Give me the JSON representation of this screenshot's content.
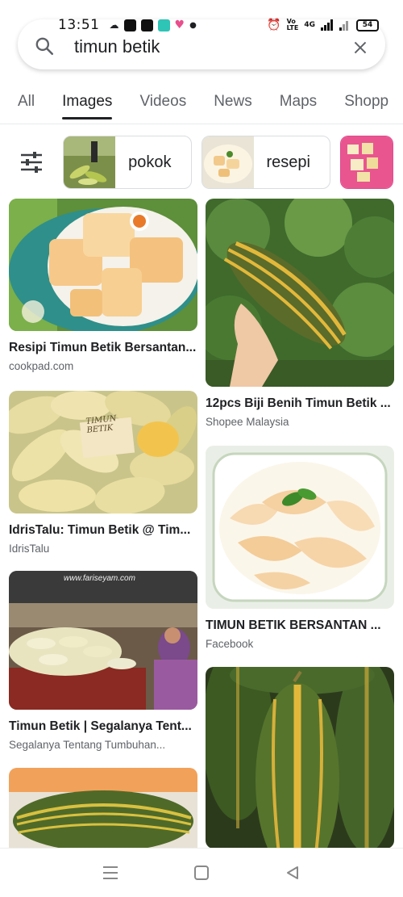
{
  "status_bar": {
    "time": "13:51",
    "right_text": "4G",
    "battery": "54"
  },
  "search": {
    "query": "timun betik"
  },
  "tabs": [
    {
      "label": "All"
    },
    {
      "label": "Images"
    },
    {
      "label": "Videos"
    },
    {
      "label": "News"
    },
    {
      "label": "Maps"
    },
    {
      "label": "Shopp"
    }
  ],
  "chips": [
    {
      "label": "pokok"
    },
    {
      "label": "resepi"
    }
  ],
  "results": {
    "left": [
      {
        "title": "Resipi Timun Betik Bersantan...",
        "source": "cookpad.com"
      },
      {
        "title": "IdrisTalu: Timun Betik @ Tim...",
        "source": "IdrisTalu",
        "image_text": "TIMUN BETIK"
      },
      {
        "title": "Timun Betik | Segalanya Tent...",
        "source": "Segalanya Tentang Tumbuhan...",
        "image_text": "www.fariseyam.com"
      },
      {
        "title": "",
        "source": ""
      }
    ],
    "right": [
      {
        "title": "12pcs Biji Benih Timun Betik ...",
        "source": "Shopee Malaysia"
      },
      {
        "title": "TIMUN BETIK BERSANTAN ...",
        "source": "Facebook"
      },
      {
        "title": "",
        "source": ""
      }
    ]
  },
  "colors": {
    "accent": "#202124",
    "muted": "#5f6368",
    "melon_green": "#5a6b2a",
    "melon_yellow": "#e3b83a"
  }
}
